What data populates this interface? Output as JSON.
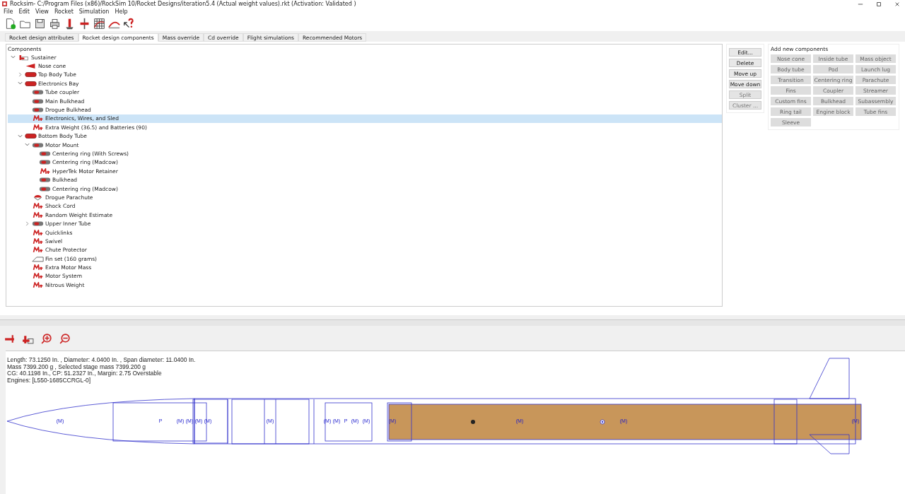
{
  "window": {
    "title": "Rocksim- C:/Program Files (x86)/RockSim 10/Rocket Designs/iteration5.4 (Actual weight values).rkt  (Activation: Validated )"
  },
  "menu": [
    "File",
    "Edit",
    "View",
    "Rocket",
    "Simulation",
    "Help"
  ],
  "tabs": [
    {
      "label": "Rocket design attributes",
      "selected": false
    },
    {
      "label": "Rocket design components",
      "selected": true
    },
    {
      "label": "Mass override",
      "selected": false
    },
    {
      "label": "Cd override",
      "selected": false
    },
    {
      "label": "Flight simulations",
      "selected": false
    },
    {
      "label": "Recommended Motors",
      "selected": false
    }
  ],
  "components": {
    "title": "Components",
    "tree": [
      {
        "label": "Sustainer",
        "kind": "stage",
        "expanded": true,
        "selected": false,
        "children": [
          {
            "label": "Nose cone",
            "kind": "nose",
            "selected": false
          },
          {
            "label": "Top Body Tube",
            "kind": "tube",
            "expanded": false,
            "selected": false
          },
          {
            "label": "Electronics Bay",
            "kind": "tube",
            "expanded": true,
            "selected": false,
            "children": [
              {
                "label": "Tube coupler",
                "kind": "ring",
                "selected": false
              },
              {
                "label": "Main Bulkhead",
                "kind": "ring",
                "selected": false
              },
              {
                "label": "Drogue Bulkhead",
                "kind": "ring",
                "selected": false
              },
              {
                "label": "Electronics, Wires, and Sled",
                "kind": "mass",
                "selected": true
              },
              {
                "label": "Extra Weight (36.5) and Batteries (90)",
                "kind": "mass",
                "selected": false
              }
            ]
          },
          {
            "label": "Bottom Body Tube",
            "kind": "tube",
            "expanded": true,
            "selected": false,
            "children": [
              {
                "label": "Motor Mount",
                "kind": "ring",
                "expanded": true,
                "selected": false,
                "children": [
                  {
                    "label": "Centering ring (With Screws)",
                    "kind": "ring",
                    "selected": false
                  },
                  {
                    "label": "Centering ring (Madcow)",
                    "kind": "ring",
                    "selected": false
                  },
                  {
                    "label": "HyperTek Motor Retainer",
                    "kind": "mass",
                    "selected": false
                  },
                  {
                    "label": "Bulkhead",
                    "kind": "ring",
                    "selected": false
                  },
                  {
                    "label": "Centering ring (Madcow)",
                    "kind": "ring",
                    "selected": false
                  }
                ]
              },
              {
                "label": "Drogue Parachute",
                "kind": "parachute",
                "selected": false
              },
              {
                "label": "Shock Cord",
                "kind": "mass",
                "selected": false
              },
              {
                "label": "Random Weight Estimate",
                "kind": "mass",
                "selected": false
              },
              {
                "label": "Upper Inner Tube",
                "kind": "ring",
                "expanded": false,
                "selected": false
              },
              {
                "label": "Quicklinks",
                "kind": "mass",
                "selected": false
              },
              {
                "label": "Swivel",
                "kind": "mass",
                "selected": false
              },
              {
                "label": "Chute Protector",
                "kind": "mass",
                "selected": false
              },
              {
                "label": "Fin set (160 grams)",
                "kind": "fin",
                "selected": false
              },
              {
                "label": "Extra Motor Mass",
                "kind": "mass",
                "selected": false
              },
              {
                "label": "Motor System",
                "kind": "mass",
                "selected": false
              },
              {
                "label": "Nitrous Weight",
                "kind": "mass",
                "selected": false
              }
            ]
          }
        ]
      }
    ]
  },
  "actions": [
    {
      "label": "Edit...",
      "disabled": false
    },
    {
      "label": "Delete",
      "disabled": false
    },
    {
      "label": "Move up",
      "disabled": false
    },
    {
      "label": "Move down",
      "disabled": false
    },
    {
      "label": "Split",
      "disabled": true
    },
    {
      "label": "Cluster ...",
      "disabled": true
    }
  ],
  "add_new_components": {
    "title": "Add new components",
    "buttons": [
      {
        "label": "Nose cone",
        "disabled": true
      },
      {
        "label": "Inside tube",
        "disabled": true
      },
      {
        "label": "Mass object",
        "disabled": true
      },
      {
        "label": "Body tube",
        "disabled": true
      },
      {
        "label": "Pod",
        "disabled": true
      },
      {
        "label": "Launch lug",
        "disabled": true
      },
      {
        "label": "Transition",
        "disabled": true
      },
      {
        "label": "Centering ring",
        "disabled": true
      },
      {
        "label": "Parachute",
        "disabled": true
      },
      {
        "label": "Fins",
        "disabled": true
      },
      {
        "label": "Coupler",
        "disabled": true
      },
      {
        "label": "Streamer",
        "disabled": true
      },
      {
        "label": "Custom fins",
        "disabled": true
      },
      {
        "label": "Bulkhead",
        "disabled": true
      },
      {
        "label": "Subassembly",
        "disabled": true
      },
      {
        "label": "Ring tail",
        "disabled": true
      },
      {
        "label": "Engine block",
        "disabled": true
      },
      {
        "label": "Tube fins",
        "disabled": true
      },
      {
        "label": "Sleeve",
        "disabled": true
      }
    ]
  },
  "summary": [
    "Length: 73.1250  In. , Diameter: 4.0400  In. , Span diameter: 11.0400  In.",
    "Mass 7399.200 g , Selected stage mass 7399.200 g",
    "CG: 40.1198 In., CP: 51.2327 In., Margin: 2.75 Overstable",
    "Engines: [L550-1685CCRGL-0]"
  ],
  "markers": [
    "(M)",
    "P",
    "(M)",
    "(M)",
    "(M)",
    "(M)",
    "(M)",
    "(M)",
    "(M)",
    "P",
    "(M)",
    "(M)",
    "(M)",
    "(M)",
    "(M)",
    "(M)"
  ]
}
